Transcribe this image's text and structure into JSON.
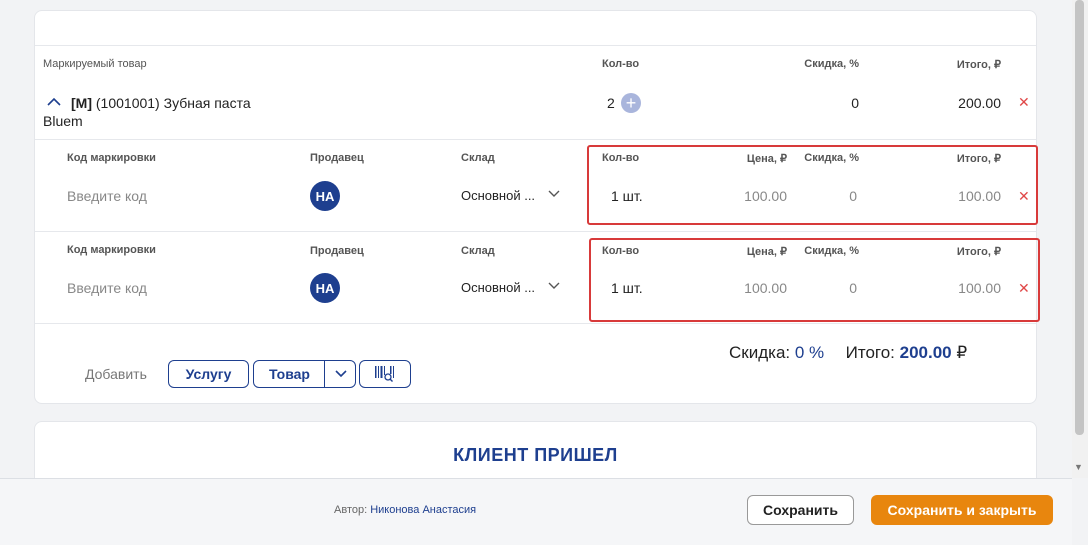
{
  "main_row": {
    "header_product": "Маркируемый товар",
    "header_qty": "Кол-во",
    "header_discount": "Скидка, %",
    "header_total": "Итого, ₽",
    "product_code_prefix": "[M]",
    "product_name_line1": "(1001001) Зубная паста",
    "product_name_line2": "Bluem",
    "qty": "2",
    "discount": "0",
    "total": "200.00"
  },
  "sub_rows": [
    {
      "h_code": "Код маркировки",
      "h_seller": "Продавец",
      "h_warehouse": "Склад",
      "h_qty": "Кол-во",
      "h_price": "Цена, ₽",
      "h_discount": "Скидка, %",
      "h_total": "Итого, ₽",
      "code_placeholder": "Введите код",
      "seller_initials": "НА",
      "warehouse": "Основной ...",
      "qty": "1 шт.",
      "price": "100.00",
      "discount": "0",
      "total": "100.00"
    },
    {
      "h_code": "Код маркировки",
      "h_seller": "Продавец",
      "h_warehouse": "Склад",
      "h_qty": "Кол-во",
      "h_price": "Цена, ₽",
      "h_discount": "Скидка, %",
      "h_total": "Итого, ₽",
      "code_placeholder": "Введите код",
      "seller_initials": "НА",
      "warehouse": "Основной ...",
      "qty": "1 шт.",
      "price": "100.00",
      "discount": "0",
      "total": "100.00"
    }
  ],
  "actions": {
    "add_label": "Добавить",
    "service_btn": "Услугу",
    "product_btn": "Товар"
  },
  "summary": {
    "discount_label": "Скидка:",
    "discount_value": "0 %",
    "total_label": "Итого:",
    "total_value": "200.00",
    "currency": "₽"
  },
  "client_section": {
    "title": "КЛИЕНТ ПРИШЕЛ"
  },
  "footer": {
    "author_label": "Автор:",
    "author_name": "Никонова Анастасия",
    "save": "Сохранить",
    "save_close": "Сохранить и закрыть"
  },
  "colors": {
    "accent": "#1e3f8f",
    "orange": "#e8860e",
    "highlight_red": "#d83a3a"
  }
}
